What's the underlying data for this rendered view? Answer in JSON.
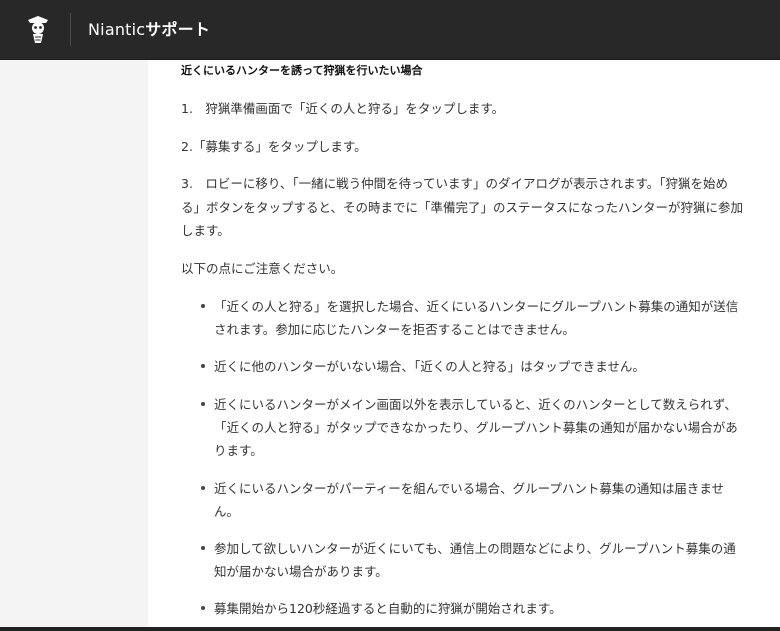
{
  "header": {
    "brand_prefix": "Niantic",
    "brand_suffix": "サポート",
    "logo_icon": "niantic-logo-icon",
    "background": "#282828"
  },
  "article": {
    "section_title": "近くにいるハンターを誘って狩猟を行いたい場合",
    "steps": [
      "1.　狩猟準備画面で「近くの人と狩る」をタップします。",
      "2.「募集する」をタップします。",
      "3.　ロビーに移り、「一緒に戦う仲間を待っています」のダイアログが表示されます。「狩猟を始める」ボタンをタップすると、その時までに「準備完了」のステータスになったハンターが狩猟に参加します。"
    ],
    "notice_intro": "以下の点にご注意ください。",
    "notes": [
      "「近くの人と狩る」を選択した場合、近くにいるハンターにグループハント募集の通知が送信されます。参加に応じたハンターを拒否することはできません。",
      "近くに他のハンターがいない場合、「近くの人と狩る」はタップできません。",
      "近くにいるハンターがメイン画面以外を表示していると、近くのハンターとして数えられず、「近くの人と狩る」がタップできなかったり、グループハント募集の通知が届かない場合があります。",
      "近くにいるハンターがパーティーを組んでいる場合、グループハント募集の通知は届きません。",
      "参加して欲しいハンターが近くにいても、通信上の問題などにより、グループハント募集の通知が届かない場合があります。",
      "募集開始から120秒経過すると自動的に狩猟が開始されます。"
    ]
  }
}
